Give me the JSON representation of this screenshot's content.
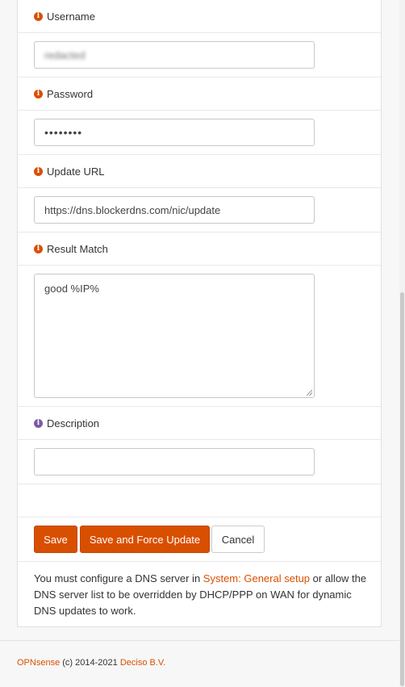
{
  "form": {
    "username": {
      "label": "Username",
      "value": "redacted"
    },
    "password": {
      "label": "Password",
      "value": "••••••••"
    },
    "update_url": {
      "label": "Update URL",
      "value": "https://dns.blockerdns.com/nic/update"
    },
    "result_match": {
      "label": "Result Match",
      "value": "good %IP%"
    },
    "description": {
      "label": "Description",
      "value": ""
    }
  },
  "buttons": {
    "save": "Save",
    "save_force": "Save and Force Update",
    "cancel": "Cancel"
  },
  "note": {
    "part1": "You must configure a DNS server in ",
    "link": "System: General setup",
    "part2": " or allow the DNS server list to be overridden by DHCP/PPP on WAN for dynamic DNS updates to work."
  },
  "footer": {
    "brand": "OPNsense",
    "copyright": " (c) 2014-2021 ",
    "company": "Deciso B.V."
  },
  "colors": {
    "accent": "#d94f00",
    "info_alt": "#7d5aa6"
  },
  "icons": {
    "info": "info-circle-icon"
  }
}
